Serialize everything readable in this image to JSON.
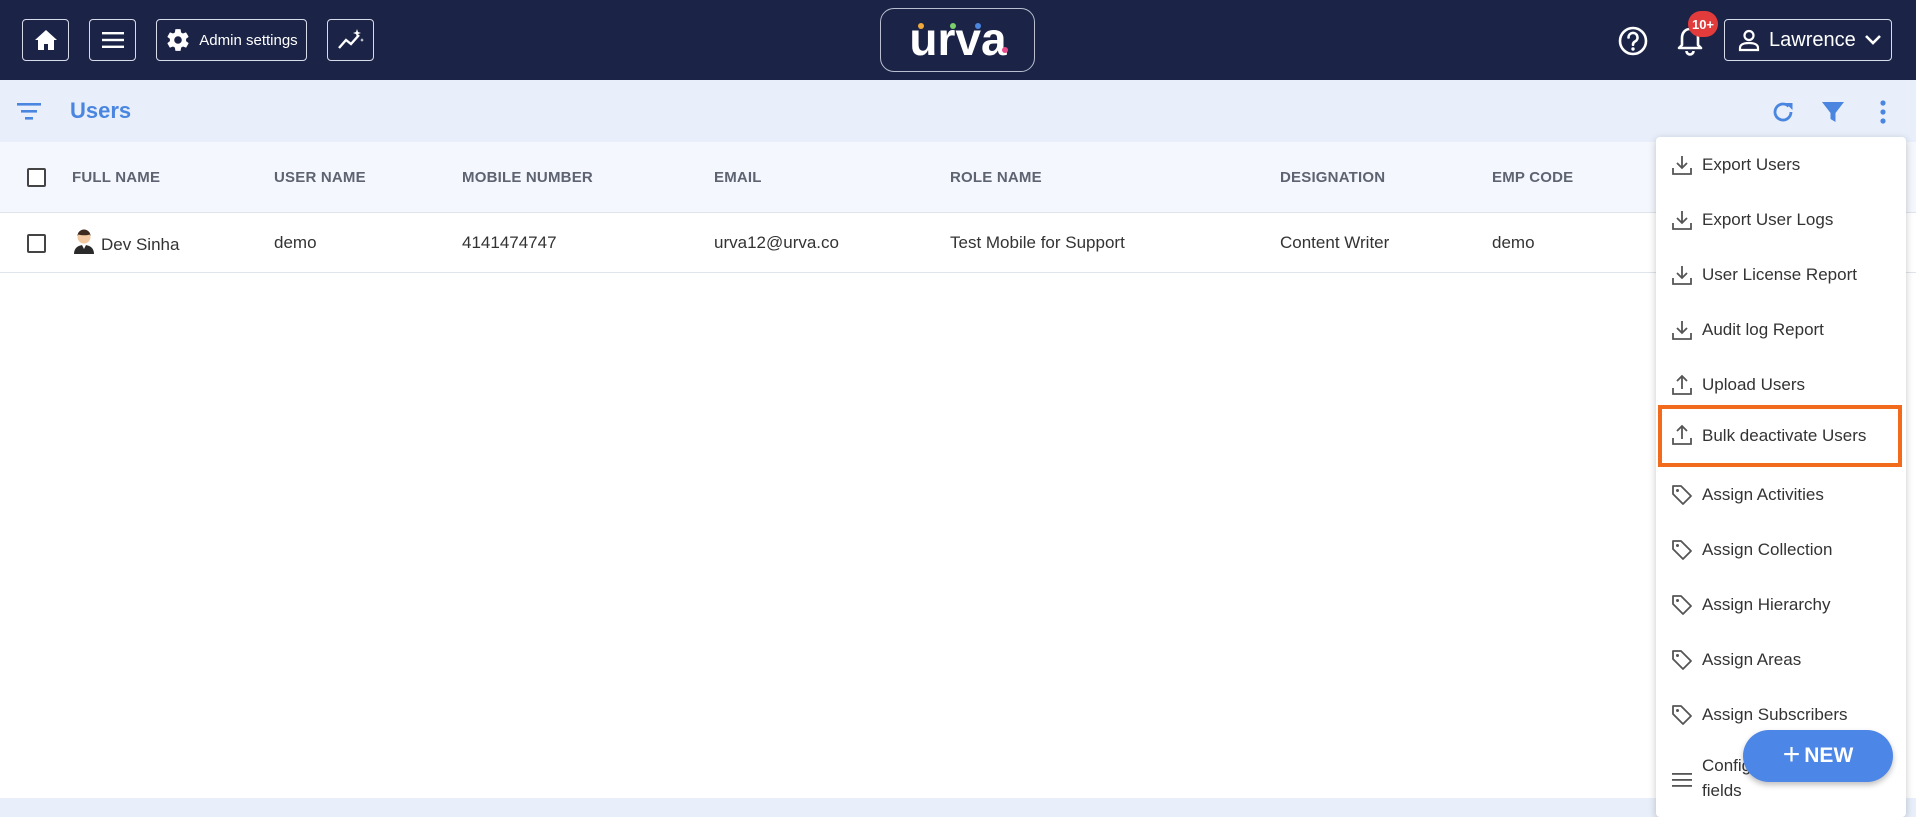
{
  "header": {
    "admin_settings_label": "Admin settings",
    "logo_text": "urva",
    "notification_badge": "10+",
    "user_name": "Lawrence",
    "colors": {
      "background": "#1b2446",
      "badge": "#e23b3b"
    }
  },
  "page": {
    "title": "Users",
    "accent": "#4a86e0"
  },
  "table": {
    "columns": [
      "FULL NAME",
      "USER NAME",
      "MOBILE NUMBER",
      "EMAIL",
      "ROLE NAME",
      "DESIGNATION",
      "EMP CODE"
    ],
    "rows": [
      {
        "full_name": "Dev Sinha",
        "user_name": "demo",
        "mobile_number": "4141474747",
        "email": "urva12@urva.co",
        "role_name": "Test Mobile for Support",
        "designation": "Content Writer",
        "emp_code": "demo"
      }
    ]
  },
  "menu": {
    "items": [
      {
        "label": "Export Users",
        "icon": "download-icon"
      },
      {
        "label": "Export User Logs",
        "icon": "download-icon"
      },
      {
        "label": "User License Report",
        "icon": "download-icon"
      },
      {
        "label": "Audit log Report",
        "icon": "download-icon"
      },
      {
        "label": "Upload Users",
        "icon": "upload-icon"
      },
      {
        "label": "Bulk deactivate Users",
        "icon": "upload-icon",
        "highlighted": true
      },
      {
        "label": "Assign Activities",
        "icon": "tag-icon"
      },
      {
        "label": "Assign Collection",
        "icon": "tag-icon"
      },
      {
        "label": "Assign Hierarchy",
        "icon": "tag-icon"
      },
      {
        "label": "Assign Areas",
        "icon": "tag-icon"
      },
      {
        "label": "Assign Subscribers",
        "icon": "tag-icon"
      },
      {
        "label": "Config",
        "label_line2": "fields",
        "icon": "list-icon"
      }
    ],
    "highlight_color": "#f26a1b"
  },
  "fab": {
    "label": "NEW",
    "plus": "+"
  }
}
